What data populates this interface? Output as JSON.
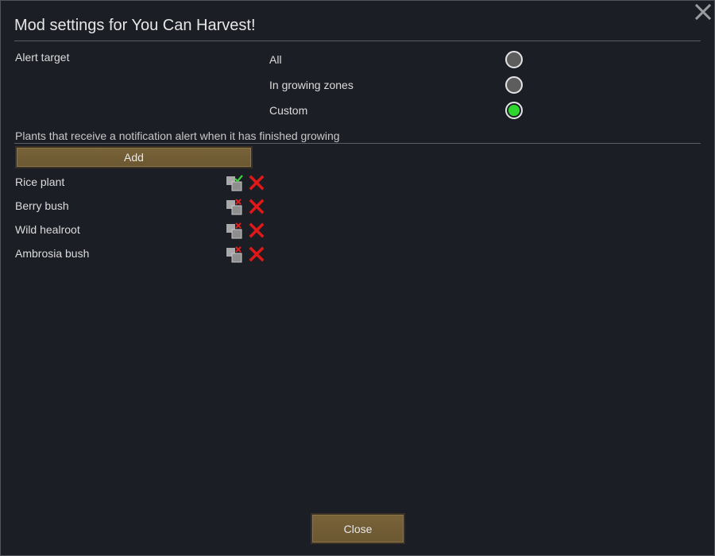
{
  "dialog": {
    "title": "Mod settings for You Can Harvest!",
    "close_label": "Close"
  },
  "alert_target": {
    "label": "Alert target",
    "options": [
      {
        "label": "All",
        "selected": false
      },
      {
        "label": "In growing zones",
        "selected": false
      },
      {
        "label": "Custom",
        "selected": true
      }
    ]
  },
  "plants": {
    "header": "Plants that receive a notification alert when it has finished growing",
    "add_label": "Add",
    "items": [
      {
        "name": "Rice plant",
        "enabled": true
      },
      {
        "name": "Berry bush",
        "enabled": false
      },
      {
        "name": "Wild healroot",
        "enabled": false
      },
      {
        "name": "Ambrosia bush",
        "enabled": false
      }
    ]
  },
  "colors": {
    "background": "#1c1e25",
    "button": "#735e35",
    "radio_selected": "#2fd52f",
    "remove_red": "#e01818",
    "check_green": "#3fd13f"
  },
  "icons": {
    "close": "close-x-icon",
    "toggle_on": "checkbox-check-icon",
    "toggle_off": "checkbox-cross-icon",
    "remove": "red-x-icon"
  }
}
